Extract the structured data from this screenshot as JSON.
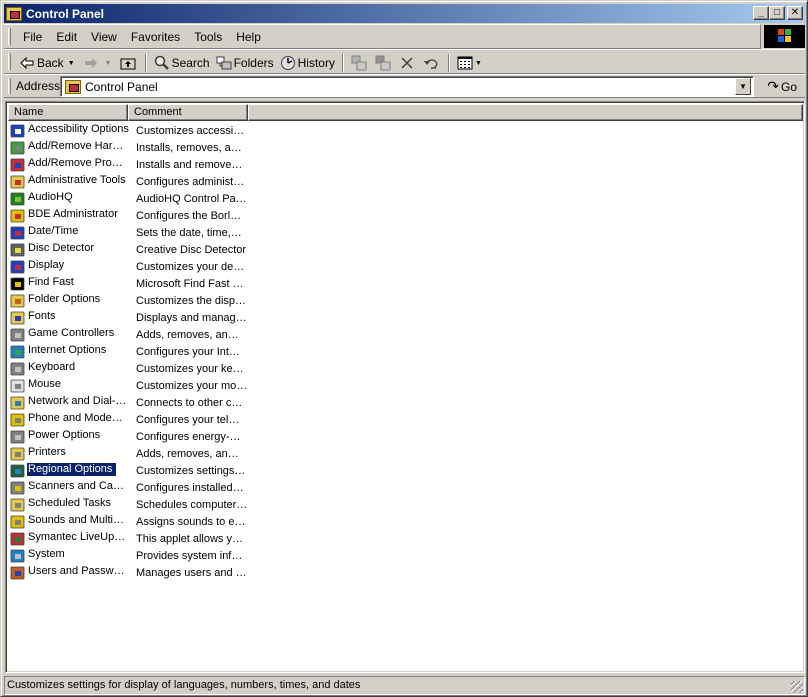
{
  "window": {
    "title": "Control Panel",
    "controls": {
      "minimize": "_",
      "maximize": "□",
      "close": "✕"
    }
  },
  "menubar": {
    "items": [
      "File",
      "Edit",
      "View",
      "Favorites",
      "Tools",
      "Help"
    ]
  },
  "toolbar": {
    "back_label": "Back",
    "search_label": "Search",
    "folders_label": "Folders",
    "history_label": "History",
    "icons": {
      "back": "back-arrow-icon",
      "forward": "forward-arrow-icon",
      "up": "up-folder-icon",
      "search": "search-icon",
      "folders": "folders-icon",
      "history": "history-icon",
      "move_to": "move-to-icon",
      "copy_to": "copy-to-icon",
      "delete": "delete-icon",
      "undo": "undo-icon",
      "views": "views-icon"
    }
  },
  "address": {
    "label": "Address",
    "value": "Control Panel",
    "go_label": "Go"
  },
  "list": {
    "columns": [
      "Name",
      "Comment"
    ],
    "items": [
      {
        "name": "Accessibility Options",
        "comment": "Customizes accessi…",
        "icon": "accessibility-icon"
      },
      {
        "name": "Add/Remove Har…",
        "comment": "Installs, removes, a…",
        "icon": "add-hardware-icon"
      },
      {
        "name": "Add/Remove Pro…",
        "comment": "Installs and remove…",
        "icon": "add-remove-programs-icon"
      },
      {
        "name": "Administrative Tools",
        "comment": "Configures administ…",
        "icon": "administrative-tools-icon"
      },
      {
        "name": "AudioHQ",
        "comment": "AudioHQ Control Pa…",
        "icon": "audiohq-icon"
      },
      {
        "name": "BDE Administrator",
        "comment": "Configures the Borl…",
        "icon": "bde-administrator-icon"
      },
      {
        "name": "Date/Time",
        "comment": "Sets the date, time,…",
        "icon": "date-time-icon"
      },
      {
        "name": "Disc Detector",
        "comment": "Creative Disc Detector",
        "icon": "disc-detector-icon"
      },
      {
        "name": "Display",
        "comment": "Customizes your de…",
        "icon": "display-icon"
      },
      {
        "name": "Find Fast",
        "comment": "Microsoft Find Fast …",
        "icon": "find-fast-icon"
      },
      {
        "name": "Folder Options",
        "comment": "Customizes the disp…",
        "icon": "folder-options-icon"
      },
      {
        "name": "Fonts",
        "comment": "Displays and manag…",
        "icon": "fonts-icon"
      },
      {
        "name": "Game Controllers",
        "comment": "Adds, removes, an…",
        "icon": "game-controllers-icon"
      },
      {
        "name": "Internet Options",
        "comment": "Configures your Int…",
        "icon": "internet-options-icon"
      },
      {
        "name": "Keyboard",
        "comment": "Customizes your ke…",
        "icon": "keyboard-icon"
      },
      {
        "name": "Mouse",
        "comment": "Customizes your mo…",
        "icon": "mouse-icon"
      },
      {
        "name": "Network and Dial-…",
        "comment": "Connects to other c…",
        "icon": "network-icon"
      },
      {
        "name": "Phone and Mode…",
        "comment": "Configures your tel…",
        "icon": "phone-modem-icon"
      },
      {
        "name": "Power Options",
        "comment": "Configures energy-…",
        "icon": "power-options-icon"
      },
      {
        "name": "Printers",
        "comment": "Adds, removes, an…",
        "icon": "printers-icon"
      },
      {
        "name": "Regional Options",
        "comment": "Customizes settings…",
        "icon": "regional-options-icon",
        "selected": true
      },
      {
        "name": "Scanners and Ca…",
        "comment": "Configures installed…",
        "icon": "scanners-cameras-icon"
      },
      {
        "name": "Scheduled Tasks",
        "comment": "Schedules computer…",
        "icon": "scheduled-tasks-icon"
      },
      {
        "name": "Sounds and Multi…",
        "comment": "Assigns sounds to e…",
        "icon": "sounds-icon"
      },
      {
        "name": "Symantec LiveUp…",
        "comment": "This applet allows y…",
        "icon": "liveupdate-icon"
      },
      {
        "name": "System",
        "comment": "Provides system inf…",
        "icon": "system-icon"
      },
      {
        "name": "Users and Passw…",
        "comment": "Manages users and …",
        "icon": "users-passwords-icon"
      }
    ]
  },
  "statusbar": {
    "text": "Customizes settings for display of languages, numbers, times, and dates"
  },
  "colors": {
    "selection": "#0a246a",
    "titlebar_start": "#0a246a",
    "titlebar_end": "#a6caf0",
    "face": "#d4d0c8"
  }
}
